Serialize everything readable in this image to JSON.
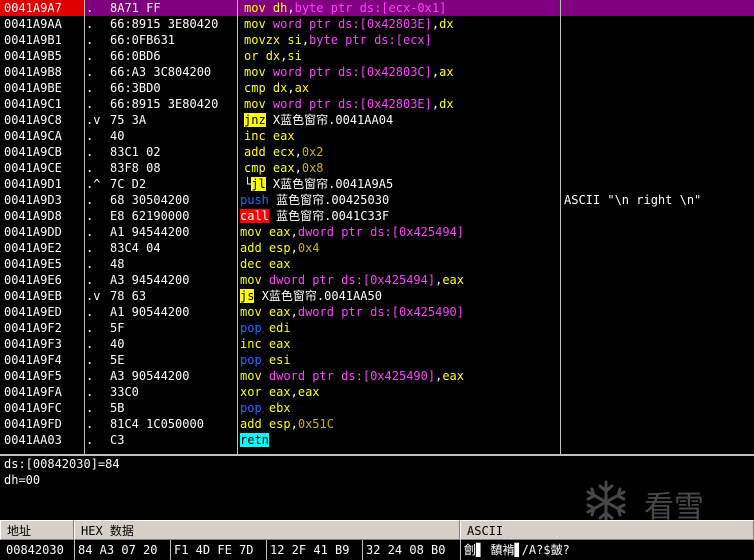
{
  "disassembly": {
    "rows": [
      {
        "addr": "0041A9A7",
        "mark": ".",
        "hex": "8A71 FF",
        "asm": [
          {
            "t": "mn",
            "v": "mov"
          },
          {
            "t": "sp",
            "v": " "
          },
          {
            "t": "reg",
            "v": "dh"
          },
          {
            "t": "txt",
            "v": ","
          },
          {
            "t": "kw",
            "v": "byte ptr ds:[ecx-0x1]"
          }
        ],
        "comment": "",
        "selected": true
      },
      {
        "addr": "0041A9AA",
        "mark": ".",
        "hex": "66:8915 3E80420",
        "asm": [
          {
            "t": "mn",
            "v": "mov"
          },
          {
            "t": "sp",
            "v": " "
          },
          {
            "t": "kw",
            "v": "word ptr ds:[0x42803E]"
          },
          {
            "t": "txt",
            "v": ","
          },
          {
            "t": "reg",
            "v": "dx"
          }
        ],
        "comment": ""
      },
      {
        "addr": "0041A9B1",
        "mark": ".",
        "hex": "66:0FB631",
        "asm": [
          {
            "t": "mn",
            "v": "movzx"
          },
          {
            "t": "sp",
            "v": " "
          },
          {
            "t": "reg",
            "v": "si"
          },
          {
            "t": "txt",
            "v": ","
          },
          {
            "t": "kw",
            "v": "byte ptr ds:[ecx]"
          }
        ],
        "comment": ""
      },
      {
        "addr": "0041A9B5",
        "mark": ".",
        "hex": "66:0BD6",
        "asm": [
          {
            "t": "mn",
            "v": "or"
          },
          {
            "t": "sp",
            "v": " "
          },
          {
            "t": "reg",
            "v": "dx"
          },
          {
            "t": "txt",
            "v": ","
          },
          {
            "t": "reg",
            "v": "si"
          }
        ],
        "comment": ""
      },
      {
        "addr": "0041A9B8",
        "mark": ".",
        "hex": "66:A3 3C804200",
        "asm": [
          {
            "t": "mn",
            "v": "mov"
          },
          {
            "t": "sp",
            "v": " "
          },
          {
            "t": "kw",
            "v": "word ptr ds:[0x42803C]"
          },
          {
            "t": "txt",
            "v": ","
          },
          {
            "t": "reg",
            "v": "ax"
          }
        ],
        "comment": ""
      },
      {
        "addr": "0041A9BE",
        "mark": ".",
        "hex": "66:3BD0",
        "asm": [
          {
            "t": "mn",
            "v": "cmp"
          },
          {
            "t": "sp",
            "v": " "
          },
          {
            "t": "reg",
            "v": "dx"
          },
          {
            "t": "txt",
            "v": ","
          },
          {
            "t": "reg",
            "v": "ax"
          }
        ],
        "comment": ""
      },
      {
        "addr": "0041A9C1",
        "mark": ".",
        "hex": "66:8915 3E80420",
        "asm": [
          {
            "t": "mn",
            "v": "mov"
          },
          {
            "t": "sp",
            "v": " "
          },
          {
            "t": "kw",
            "v": "word ptr ds:[0x42803E]"
          },
          {
            "t": "txt",
            "v": ","
          },
          {
            "t": "reg",
            "v": "dx"
          }
        ],
        "comment": ""
      },
      {
        "addr": "0041A9C8",
        "mark": ".v",
        "hex": "75 3A",
        "asm": [
          {
            "t": "jmp",
            "v": "jnz"
          },
          {
            "t": "sp",
            "v": " "
          },
          {
            "t": "txt",
            "v": "X蓝色窗帘.0041AA04"
          }
        ],
        "comment": ""
      },
      {
        "addr": "0041A9CA",
        "mark": ".",
        "hex": "40",
        "asm": [
          {
            "t": "mn",
            "v": "inc"
          },
          {
            "t": "sp",
            "v": " "
          },
          {
            "t": "reg",
            "v": "eax"
          }
        ],
        "comment": ""
      },
      {
        "addr": "0041A9CB",
        "mark": ".",
        "hex": "83C1 02",
        "asm": [
          {
            "t": "mn",
            "v": "add"
          },
          {
            "t": "sp",
            "v": " "
          },
          {
            "t": "reg",
            "v": "ecx"
          },
          {
            "t": "txt",
            "v": ","
          },
          {
            "t": "num",
            "v": "0x2"
          }
        ],
        "comment": ""
      },
      {
        "addr": "0041A9CE",
        "mark": ".",
        "hex": "83F8 08",
        "asm": [
          {
            "t": "mn",
            "v": "cmp"
          },
          {
            "t": "sp",
            "v": " "
          },
          {
            "t": "reg",
            "v": "eax"
          },
          {
            "t": "txt",
            "v": ","
          },
          {
            "t": "num",
            "v": "0x8"
          }
        ],
        "comment": ""
      },
      {
        "addr": "0041A9D1",
        "mark": ".^",
        "hex": "7C D2",
        "asm": [
          {
            "t": "txt",
            "v": "└"
          },
          {
            "t": "jmp",
            "v": "jl"
          },
          {
            "t": "sp",
            "v": " "
          },
          {
            "t": "txt",
            "v": "X蓝色窗帘.0041A9A5"
          }
        ],
        "comment": ""
      },
      {
        "addr": "0041A9D3",
        "mark": ".",
        "hex": "68 30504200",
        "asm": [
          {
            "t": "stk",
            "v": "push"
          },
          {
            "t": "sp",
            "v": " "
          },
          {
            "t": "txt",
            "v": "蓝色窗帘.00425030"
          }
        ],
        "comment": "ASCII \"\\n right \\n\"",
        "pad": true
      },
      {
        "addr": "0041A9D8",
        "mark": ".",
        "hex": "E8 62190000",
        "asm": [
          {
            "t": "call",
            "v": "call"
          },
          {
            "t": "sp",
            "v": " "
          },
          {
            "t": "txt",
            "v": "蓝色窗帘.0041C33F"
          }
        ],
        "comment": "",
        "pad": true
      },
      {
        "addr": "0041A9DD",
        "mark": ".",
        "hex": "A1 94544200",
        "asm": [
          {
            "t": "mn",
            "v": "mov"
          },
          {
            "t": "sp",
            "v": " "
          },
          {
            "t": "reg",
            "v": "eax"
          },
          {
            "t": "txt",
            "v": ","
          },
          {
            "t": "kw",
            "v": "dword ptr ds:[0x425494]"
          }
        ],
        "comment": "",
        "pad": true
      },
      {
        "addr": "0041A9E2",
        "mark": ".",
        "hex": "83C4 04",
        "asm": [
          {
            "t": "mn",
            "v": "add"
          },
          {
            "t": "sp",
            "v": " "
          },
          {
            "t": "reg",
            "v": "esp"
          },
          {
            "t": "txt",
            "v": ","
          },
          {
            "t": "num",
            "v": "0x4"
          }
        ],
        "comment": "",
        "pad": true
      },
      {
        "addr": "0041A9E5",
        "mark": ".",
        "hex": "48",
        "asm": [
          {
            "t": "mn",
            "v": "dec"
          },
          {
            "t": "sp",
            "v": " "
          },
          {
            "t": "reg",
            "v": "eax"
          }
        ],
        "comment": "",
        "pad": true
      },
      {
        "addr": "0041A9E6",
        "mark": ".",
        "hex": "A3 94544200",
        "asm": [
          {
            "t": "mn",
            "v": "mov"
          },
          {
            "t": "sp",
            "v": " "
          },
          {
            "t": "kw",
            "v": "dword ptr ds:[0x425494]"
          },
          {
            "t": "txt",
            "v": ","
          },
          {
            "t": "reg",
            "v": "eax"
          }
        ],
        "comment": "",
        "pad": true
      },
      {
        "addr": "0041A9EB",
        "mark": ".v",
        "hex": "78 63",
        "asm": [
          {
            "t": "jmp",
            "v": "js"
          },
          {
            "t": "sp",
            "v": " "
          },
          {
            "t": "txt",
            "v": "X蓝色窗帘.0041AA50"
          }
        ],
        "comment": "",
        "pad": true
      },
      {
        "addr": "0041A9ED",
        "mark": ".",
        "hex": "A1 90544200",
        "asm": [
          {
            "t": "mn",
            "v": "mov"
          },
          {
            "t": "sp",
            "v": " "
          },
          {
            "t": "reg",
            "v": "eax"
          },
          {
            "t": "txt",
            "v": ","
          },
          {
            "t": "kw",
            "v": "dword ptr ds:[0x425490]"
          }
        ],
        "comment": "",
        "pad": true
      },
      {
        "addr": "0041A9F2",
        "mark": ".",
        "hex": "5F",
        "asm": [
          {
            "t": "stk",
            "v": "pop"
          },
          {
            "t": "sp",
            "v": " "
          },
          {
            "t": "reg",
            "v": "edi"
          }
        ],
        "comment": "",
        "pad": true
      },
      {
        "addr": "0041A9F3",
        "mark": ".",
        "hex": "40",
        "asm": [
          {
            "t": "mn",
            "v": "inc"
          },
          {
            "t": "sp",
            "v": " "
          },
          {
            "t": "reg",
            "v": "eax"
          }
        ],
        "comment": "",
        "pad": true
      },
      {
        "addr": "0041A9F4",
        "mark": ".",
        "hex": "5E",
        "asm": [
          {
            "t": "stk",
            "v": "pop"
          },
          {
            "t": "sp",
            "v": " "
          },
          {
            "t": "reg",
            "v": "esi"
          }
        ],
        "comment": "",
        "pad": true
      },
      {
        "addr": "0041A9F5",
        "mark": ".",
        "hex": "A3 90544200",
        "asm": [
          {
            "t": "mn",
            "v": "mov"
          },
          {
            "t": "sp",
            "v": " "
          },
          {
            "t": "kw",
            "v": "dword ptr ds:[0x425490]"
          },
          {
            "t": "txt",
            "v": ","
          },
          {
            "t": "reg",
            "v": "eax"
          }
        ],
        "comment": "",
        "pad": true
      },
      {
        "addr": "0041A9FA",
        "mark": ".",
        "hex": "33C0",
        "asm": [
          {
            "t": "mn",
            "v": "xor"
          },
          {
            "t": "sp",
            "v": " "
          },
          {
            "t": "reg",
            "v": "eax"
          },
          {
            "t": "txt",
            "v": ","
          },
          {
            "t": "reg",
            "v": "eax"
          }
        ],
        "comment": "",
        "pad": true
      },
      {
        "addr": "0041A9FC",
        "mark": ".",
        "hex": "5B",
        "asm": [
          {
            "t": "stk",
            "v": "pop"
          },
          {
            "t": "sp",
            "v": " "
          },
          {
            "t": "reg",
            "v": "ebx"
          }
        ],
        "comment": "",
        "pad": true
      },
      {
        "addr": "0041A9FD",
        "mark": ".",
        "hex": "81C4 1C050000",
        "asm": [
          {
            "t": "mn",
            "v": "add"
          },
          {
            "t": "sp",
            "v": " "
          },
          {
            "t": "reg",
            "v": "esp"
          },
          {
            "t": "txt",
            "v": ","
          },
          {
            "t": "num",
            "v": "0x51C"
          }
        ],
        "comment": "",
        "pad": true
      },
      {
        "addr": "0041AA03",
        "mark": ".",
        "hex": "C3",
        "asm": [
          {
            "t": "ret",
            "v": "retn"
          }
        ],
        "comment": "",
        "pad": true
      }
    ]
  },
  "info": {
    "line1": "ds:[00842030]=84",
    "line2": "dh=00"
  },
  "dump": {
    "col_address": "地址",
    "col_hex": "HEX 数据",
    "col_ascii": "ASCII",
    "row": {
      "addr": "00842030",
      "hex1": "84 A3 07 20",
      "hex2": "F1 4D FE 7D",
      "hex3": "12 2F 41 B9",
      "hex4": "32 24 08 B0",
      "ascii": "劊▋ 馩褃▋/A?$皼?"
    }
  },
  "watermark": {
    "text": "看雪",
    "icon": "snowflake-icon"
  }
}
